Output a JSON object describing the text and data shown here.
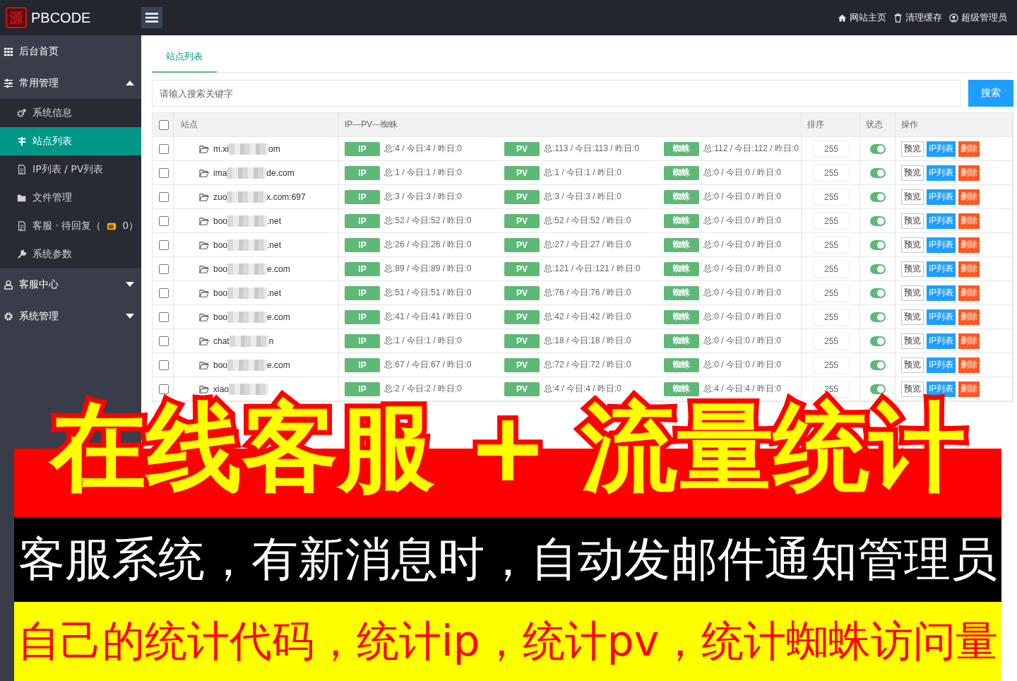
{
  "topbar": {
    "logo_mark": "源",
    "logo_text": "PBCODE",
    "links": [
      {
        "kind": "home",
        "label": "网站主页"
      },
      {
        "kind": "trash",
        "label": "清理缓存"
      },
      {
        "kind": "user",
        "label": "超级管理员"
      }
    ]
  },
  "sidebar": {
    "items": [
      {
        "kind": "grid",
        "label": "后台首页"
      },
      {
        "kind": "sliders",
        "label": "常用管理",
        "expanded": true,
        "children": [
          {
            "kind": "gears",
            "label": "系统信息",
            "selected": false
          },
          {
            "kind": "sites",
            "label": "站点列表",
            "selected": true
          },
          {
            "kind": "doc",
            "label": "IP列表 / PV列表",
            "selected": false
          },
          {
            "kind": "folder",
            "label": "文件管理",
            "selected": false
          },
          {
            "kind": "doc",
            "label": "客服 · 待回复（",
            "count": "0）",
            "selected": false
          },
          {
            "kind": "wrench",
            "label": "系统参数",
            "selected": false
          }
        ]
      },
      {
        "kind": "person",
        "label": "客服中心",
        "expanded": false
      },
      {
        "kind": "gear",
        "label": "系统管理",
        "expanded": false
      }
    ]
  },
  "tabs": [
    {
      "label": "站点列表",
      "selected": true
    }
  ],
  "search": {
    "placeholder": "请输入搜索关键字",
    "button": "搜索"
  },
  "table": {
    "columns": [
      "站点",
      "IP---PV---蜘蛛",
      "排序",
      "状态",
      "操作"
    ],
    "header_checked": false,
    "rows": [
      {
        "checked": false,
        "site_start": "m.xi",
        "site_end": "om",
        "stats": [
          {
            "badge": "IP",
            "text": "总:4 / 今日:4 / 昨日:0"
          },
          {
            "badge": "PV",
            "text": "总:113 / 今日:113 / 昨日:0"
          },
          {
            "badge": "蜘蛛",
            "text": "总:112 / 今日:112 / 昨日:0"
          }
        ],
        "sort": "255",
        "on": true,
        "buttons": [
          "预览",
          "IP列表",
          "删除"
        ]
      },
      {
        "checked": false,
        "site_start": "ima",
        "site_end": "de.com",
        "stats": [
          {
            "badge": "IP",
            "text": "总:1 / 今日:1 / 昨日:0"
          },
          {
            "badge": "PV",
            "text": "总:1 / 今日:1 / 昨日:0"
          },
          {
            "badge": "蜘蛛",
            "text": "总:0 / 今日:0 / 昨日:0"
          }
        ],
        "sort": "255",
        "on": true,
        "buttons": [
          "预览",
          "IP列表",
          "删除"
        ]
      },
      {
        "checked": false,
        "site_start": "zuo",
        "site_end": "x.com:697",
        "stats": [
          {
            "badge": "IP",
            "text": "总:3 / 今日:3 / 昨日:0"
          },
          {
            "badge": "PV",
            "text": "总:3 / 今日:3 / 昨日:0"
          },
          {
            "badge": "蜘蛛",
            "text": "总:0 / 今日:0 / 昨日:0"
          }
        ],
        "sort": "255",
        "on": true,
        "buttons": [
          "预览",
          "IP列表",
          "删除"
        ]
      },
      {
        "checked": false,
        "site_start": "boo",
        "site_end": ".net",
        "stats": [
          {
            "badge": "IP",
            "text": "总:52 / 今日:52 / 昨日:0"
          },
          {
            "badge": "PV",
            "text": "总:52 / 今日:52 / 昨日:0"
          },
          {
            "badge": "蜘蛛",
            "text": "总:0 / 今日:0 / 昨日:0"
          }
        ],
        "sort": "255",
        "on": true,
        "buttons": [
          "预览",
          "IP列表",
          "删除"
        ]
      },
      {
        "checked": false,
        "site_start": "boo",
        "site_end": ".net",
        "stats": [
          {
            "badge": "IP",
            "text": "总:26 / 今日:26 / 昨日:0"
          },
          {
            "badge": "PV",
            "text": "总:27 / 今日:27 / 昨日:0"
          },
          {
            "badge": "蜘蛛",
            "text": "总:0 / 今日:0 / 昨日:0"
          }
        ],
        "sort": "255",
        "on": true,
        "buttons": [
          "预览",
          "IP列表",
          "删除"
        ]
      },
      {
        "checked": false,
        "site_start": "boo",
        "site_end": "e.com",
        "stats": [
          {
            "badge": "IP",
            "text": "总:89 / 今日:89 / 昨日:0"
          },
          {
            "badge": "PV",
            "text": "总:121 / 今日:121 / 昨日:0"
          },
          {
            "badge": "蜘蛛",
            "text": "总:0 / 今日:0 / 昨日:0"
          }
        ],
        "sort": "255",
        "on": true,
        "buttons": [
          "预览",
          "IP列表",
          "删除"
        ]
      },
      {
        "checked": false,
        "site_start": "boo",
        "site_end": ".net",
        "stats": [
          {
            "badge": "IP",
            "text": "总:51 / 今日:51 / 昨日:0"
          },
          {
            "badge": "PV",
            "text": "总:76 / 今日:76 / 昨日:0"
          },
          {
            "badge": "蜘蛛",
            "text": "总:0 / 今日:0 / 昨日:0"
          }
        ],
        "sort": "255",
        "on": true,
        "buttons": [
          "预览",
          "IP列表",
          "删除"
        ]
      },
      {
        "checked": false,
        "site_start": "boo",
        "site_end": "e.com",
        "stats": [
          {
            "badge": "IP",
            "text": "总:41 / 今日:41 / 昨日:0"
          },
          {
            "badge": "PV",
            "text": "总:42 / 今日:42 / 昨日:0"
          },
          {
            "badge": "蜘蛛",
            "text": "总:0 / 今日:0 / 昨日:0"
          }
        ],
        "sort": "255",
        "on": true,
        "buttons": [
          "预览",
          "IP列表",
          "删除"
        ]
      },
      {
        "checked": false,
        "site_start": "chat",
        "site_end": "n",
        "stats": [
          {
            "badge": "IP",
            "text": "总:1 / 今日:1 / 昨日:0"
          },
          {
            "badge": "PV",
            "text": "总:18 / 今日:18 / 昨日:0"
          },
          {
            "badge": "蜘蛛",
            "text": "总:0 / 今日:0 / 昨日:0"
          }
        ],
        "sort": "255",
        "on": true,
        "buttons": [
          "预览",
          "IP列表",
          "删除"
        ]
      },
      {
        "checked": false,
        "site_start": "boo",
        "site_end": "e.com",
        "stats": [
          {
            "badge": "IP",
            "text": "总:67 / 今日:67 / 昨日:0"
          },
          {
            "badge": "PV",
            "text": "总:72 / 今日:72 / 昨日:0"
          },
          {
            "badge": "蜘蛛",
            "text": "总:0 / 今日:0 / 昨日:0"
          }
        ],
        "sort": "255",
        "on": true,
        "buttons": [
          "预览",
          "IP列表",
          "删除"
        ]
      },
      {
        "checked": false,
        "site_start": "xiao",
        "stats": [
          {
            "badge": "IP",
            "text": "总:2 / 今日:2 / 昨日:0"
          },
          {
            "badge": "PV",
            "text": "总:4 / 今日:4 / 昨日:0"
          },
          {
            "badge": "蜘蛛",
            "text": "总:4 / 今日:4 / 昨日:0"
          }
        ],
        "sort": "255",
        "on": true,
        "buttons": [
          "预览",
          "IP列表",
          "删除"
        ]
      }
    ]
  },
  "banner": {
    "headline": "在线客服 + 流量统计",
    "line_2": "客服系统，有新消息时，自动发邮件通知管理员",
    "line_3": "自己的统计代码，统计ip，统计pv，统计蜘蛛访问量"
  }
}
